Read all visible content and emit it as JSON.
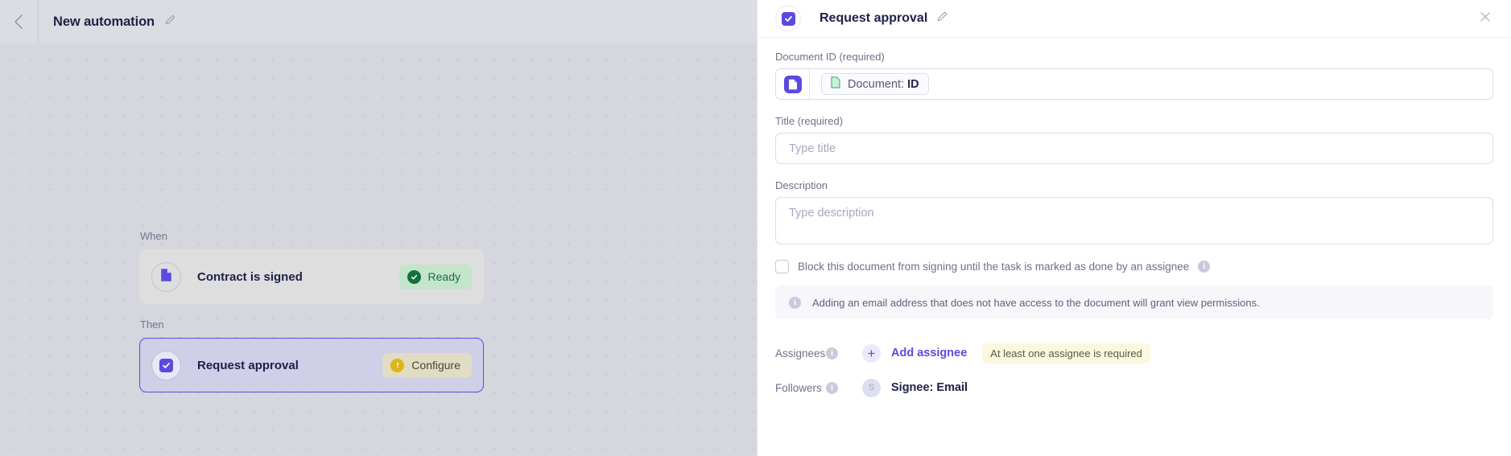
{
  "topbar": {
    "back_icon": "chevron-left-icon",
    "title": "New automation",
    "edit_icon": "pencil-icon"
  },
  "canvas": {
    "when_label": "When",
    "then_label": "Then",
    "nodes": [
      {
        "icon": "document-icon",
        "label": "Contract is signed",
        "status": "Ready",
        "status_kind": "ready",
        "status_icon": "check-circle-icon"
      },
      {
        "icon": "checkbox-icon",
        "label": "Request approval",
        "status": "Configure",
        "status_kind": "configure",
        "status_icon": "exclamation-circle-icon"
      }
    ]
  },
  "panel": {
    "header": {
      "icon": "checkbox-icon",
      "title": "Request approval",
      "edit_icon": "pencil-icon",
      "close_icon": "close-icon"
    },
    "document_id": {
      "label": "Document ID (required)",
      "source_icon": "document-source-icon",
      "token_icon": "document-token-icon",
      "token_prefix": "Document: ",
      "token_value": "ID"
    },
    "title_field": {
      "label": "Title (required)",
      "placeholder": "Type title",
      "value": ""
    },
    "description_field": {
      "label": "Description",
      "placeholder": "Type description",
      "value": ""
    },
    "block_checkbox": {
      "checked": false,
      "label": "Block this document from signing until the task is marked as done by an assignee",
      "info_icon": "info-icon",
      "info_glyph": "i"
    },
    "notice": {
      "icon": "info-icon",
      "glyph": "i",
      "text": "Adding an email address that does not have access to the document will grant view permissions."
    },
    "assignees": {
      "label": "Assignees",
      "info_icon": "info-icon",
      "info_glyph": "i",
      "plus_glyph": "+",
      "add_label": "Add assignee",
      "warning": "At least one assignee is required"
    },
    "followers": {
      "label": "Followers",
      "info_icon": "info-icon",
      "info_glyph": "i",
      "avatar_initial": "S",
      "name": "Signee: Email"
    }
  },
  "colors": {
    "accent": "#5b4ae0",
    "ready_bg": "#c3e5cc",
    "ready_text": "#16703a",
    "configure_bg": "#e0ddc4",
    "warn_bg": "#fbf8dd"
  }
}
